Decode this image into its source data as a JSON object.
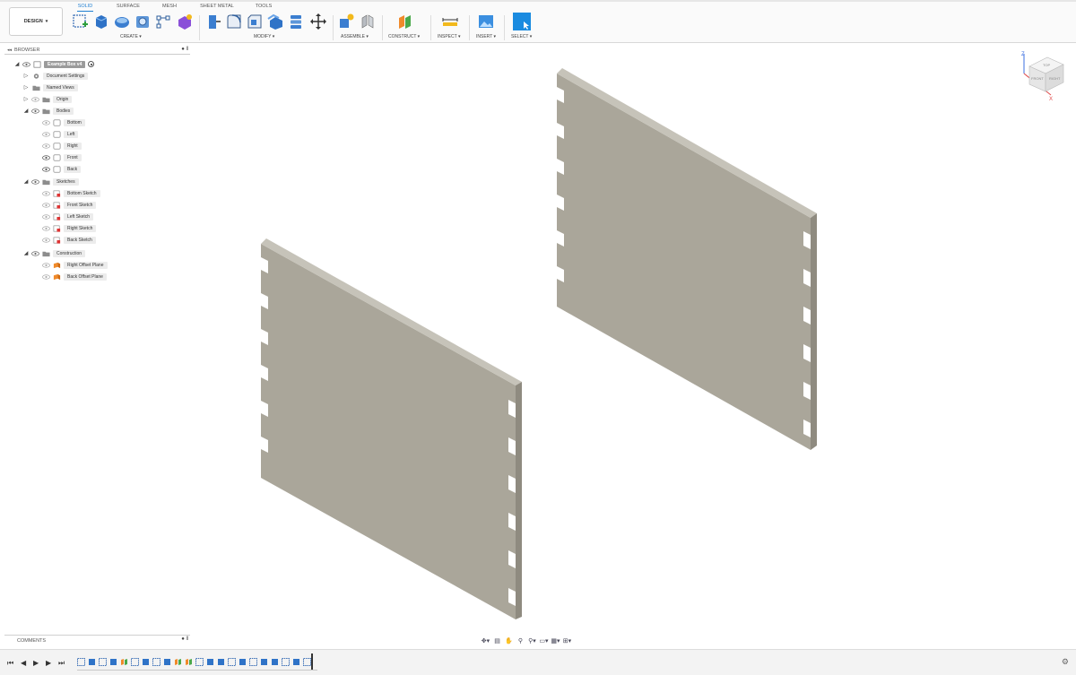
{
  "toolbar": {
    "workspace": "DESIGN",
    "tabs": [
      "SOLID",
      "SURFACE",
      "MESH",
      "SHEET METAL",
      "TOOLS"
    ],
    "active_tab": "SOLID",
    "groups": [
      "CREATE ▾",
      "MODIFY ▾",
      "ASSEMBLE ▾",
      "CONSTRUCT ▾",
      "INSPECT ▾",
      "INSERT ▾",
      "SELECT ▾"
    ]
  },
  "browser": {
    "title": "BROWSER",
    "root": "Example Box v4",
    "items": [
      "Document Settings",
      "Named Views",
      "Origin",
      "Bodies",
      "Bottom",
      "Left",
      "Right",
      "Front",
      "Back",
      "Sketches",
      "Bottom Sketch",
      "Front Sketch",
      "Left Sketch",
      "Right Sketch",
      "Back Sketch",
      "Construction",
      "Right Offset Plane",
      "Back Offset Plane"
    ]
  },
  "comments": {
    "title": "COMMENTS"
  },
  "viewcube": {
    "top": "TOP",
    "front": "FRONT",
    "right": "RIGHT",
    "axis_x": "X",
    "axis_z": "Z"
  },
  "colors": {
    "accent": "#1f7fd1",
    "body": "#a8a498",
    "body_top": "#c3c0b6",
    "body_edge": "#8f8b80"
  }
}
